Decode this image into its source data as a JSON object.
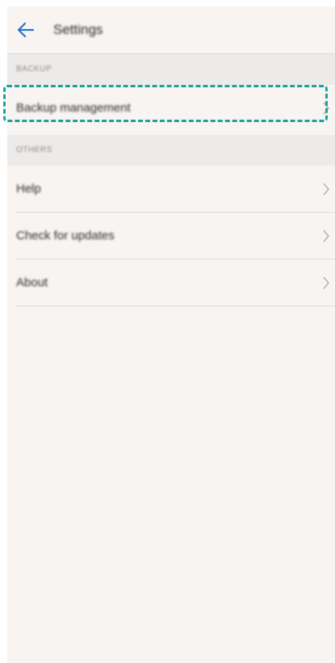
{
  "header": {
    "title": "Settings",
    "back_icon": "back-arrow-icon",
    "accent_color": "#2a73c9"
  },
  "sections": [
    {
      "heading": "BACKUP",
      "items": [
        {
          "label": "Backup management",
          "icon": "chevron-right-icon",
          "highlighted": true
        }
      ]
    },
    {
      "heading": "OTHERS",
      "items": [
        {
          "label": "Help",
          "icon": "chevron-right-icon"
        },
        {
          "label": "Check for updates",
          "icon": "chevron-right-icon"
        },
        {
          "label": "About",
          "icon": "chevron-right-icon"
        }
      ]
    }
  ],
  "highlight_color": "#1aa39a"
}
